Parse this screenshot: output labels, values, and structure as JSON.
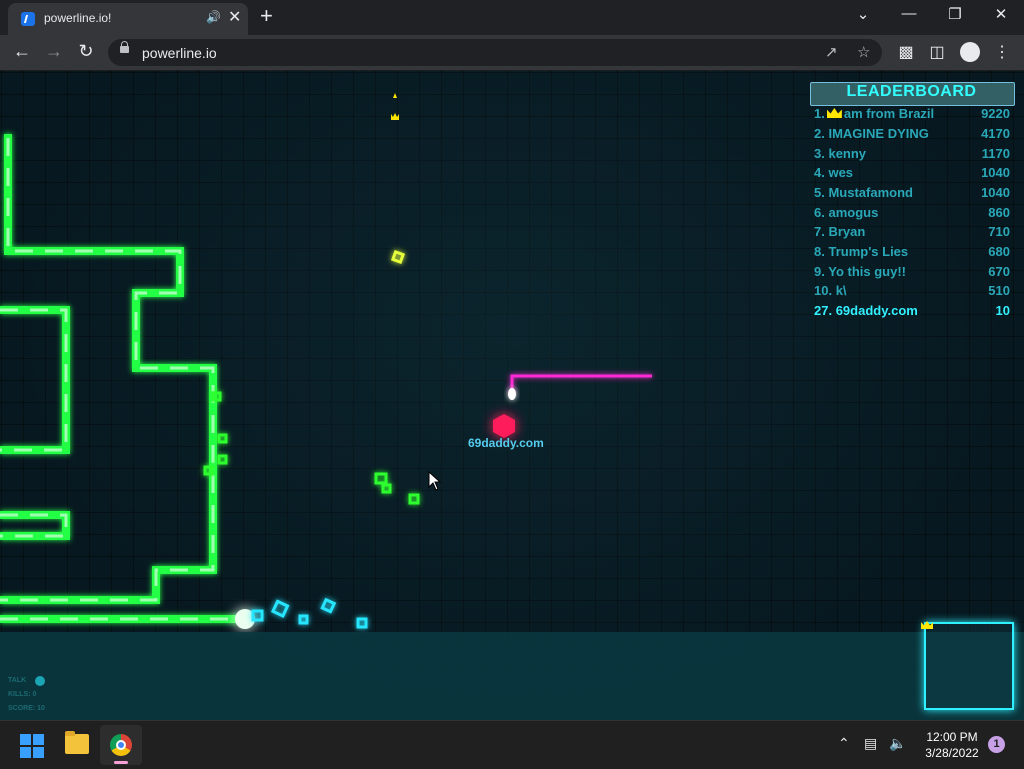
{
  "browser": {
    "tab_title": "powerline.io!",
    "url": "powerline.io"
  },
  "leaderboard": {
    "title": "LEADERBOARD",
    "rows": [
      {
        "rank": "1.",
        "name": "am from Brazil",
        "score": "9220",
        "crown": true
      },
      {
        "rank": "2.",
        "name": "IMAGINE DYING",
        "score": "4170"
      },
      {
        "rank": "3.",
        "name": "kenny",
        "score": "1170"
      },
      {
        "rank": "4.",
        "name": "wes",
        "score": "1040"
      },
      {
        "rank": "5.",
        "name": "Mustafamond",
        "score": "1040"
      },
      {
        "rank": "6.",
        "name": "amogus",
        "score": "860"
      },
      {
        "rank": "7.",
        "name": "Bryan",
        "score": "710"
      },
      {
        "rank": "8.",
        "name": "Trump's Lies",
        "score": "680"
      },
      {
        "rank": "9.",
        "name": "Yo this guy!!",
        "score": "670"
      },
      {
        "rank": "10.",
        "name": "k\\",
        "score": "510"
      }
    ],
    "self": {
      "rank": "27.",
      "name": "69daddy.com",
      "score": "10"
    }
  },
  "player": {
    "name": "69daddy.com",
    "color": "#ff1f5a"
  },
  "stats": {
    "talk": "TALK",
    "kills": "KILLS: 0",
    "score": "SCORE: 10"
  },
  "colors": {
    "wall_neon": "#22ff44",
    "trail_magenta": "#ff2bd6",
    "border_cyan": "#3df6ff"
  },
  "taskbar": {
    "time": "12:00 PM",
    "date": "3/28/2022",
    "notifications": "1"
  }
}
